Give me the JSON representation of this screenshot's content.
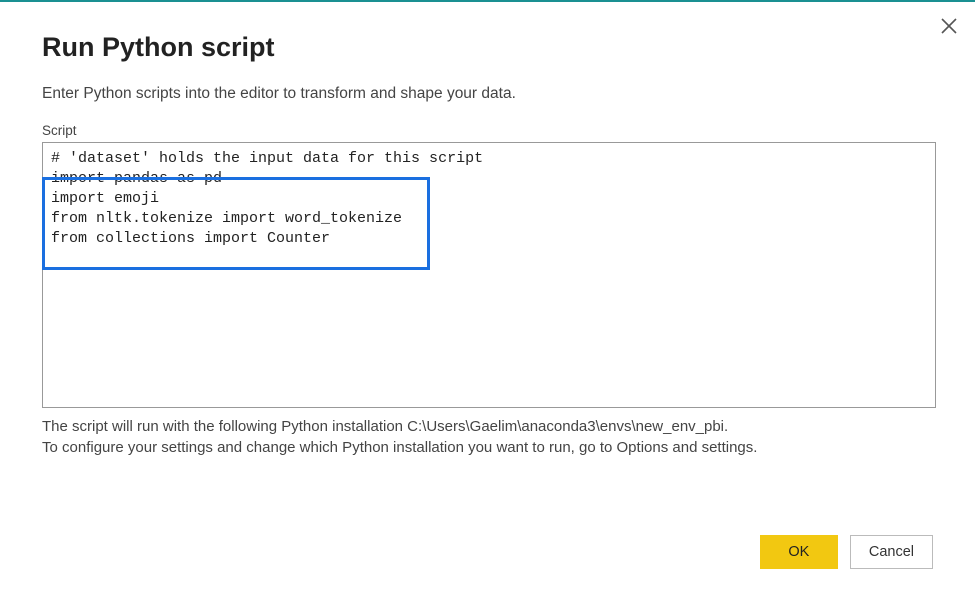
{
  "dialog": {
    "title": "Run Python script",
    "subtitle": "Enter Python scripts into the editor to transform and shape your data.",
    "script_label": "Script",
    "script_text": "# 'dataset' holds the input data for this script\nimport pandas as pd\nimport emoji\nfrom nltk.tokenize import word_tokenize\nfrom collections import Counter",
    "info_line1": "The script will run with the following Python installation C:\\Users\\Gaelim\\anaconda3\\envs\\new_env_pbi.",
    "info_line2": "To configure your settings and change which Python installation you want to run, go to Options and settings.",
    "buttons": {
      "ok": "OK",
      "cancel": "Cancel"
    }
  }
}
